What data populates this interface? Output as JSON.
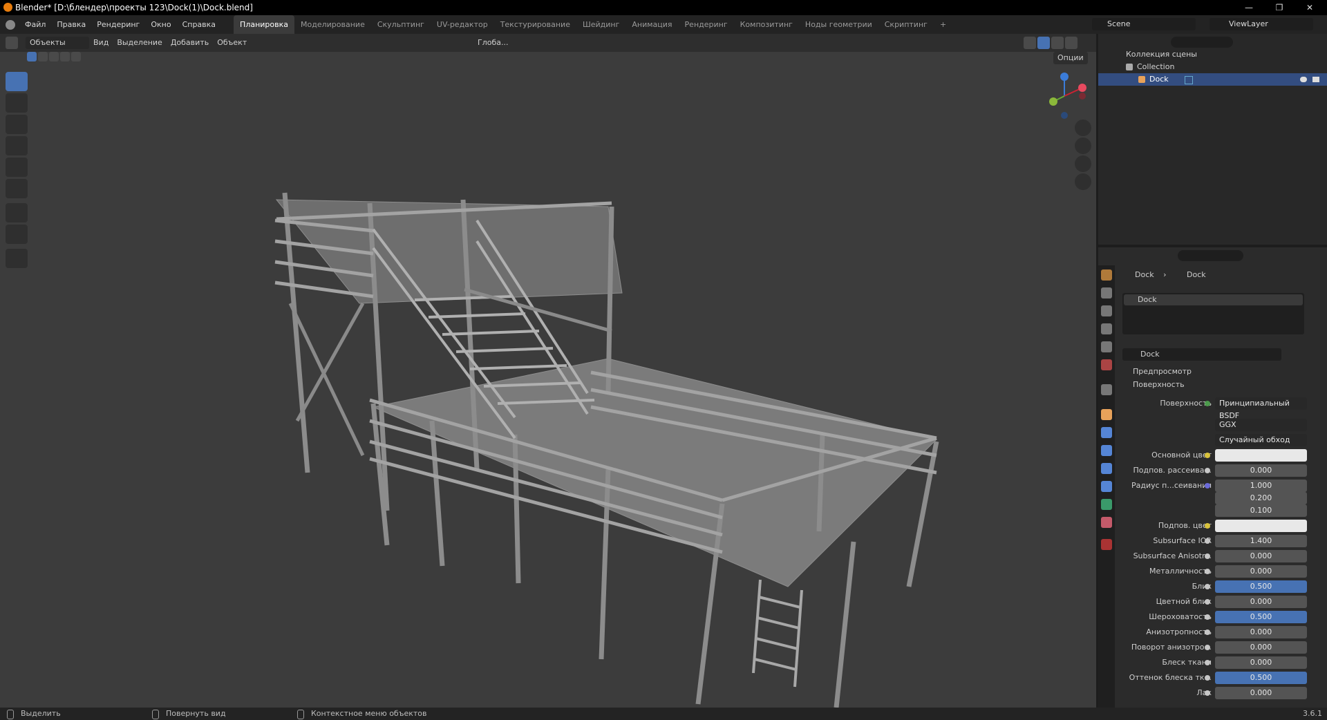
{
  "titlebar": {
    "title": "Blender* [D:\\блендер\\проекты 123\\Dock(1)\\Dock.blend]",
    "minimize": "—",
    "maximize": "❐",
    "close": "✕"
  },
  "menu": {
    "items": [
      "Файл",
      "Правка",
      "Рендеринг",
      "Окно",
      "Справка"
    ]
  },
  "workspaces": {
    "tabs": [
      "Планировка",
      "Моделирование",
      "Скульптинг",
      "UV-редактор",
      "Текстурирование",
      "Шейдинг",
      "Анимация",
      "Рендеринг",
      "Композитинг",
      "Ноды геометрии",
      "Скриптинг"
    ],
    "add": "+"
  },
  "scene": {
    "label": "Scene",
    "view_layer": "ViewLayer"
  },
  "viewport_header": {
    "mode": "Объекты",
    "items": [
      "Вид",
      "Выделение",
      "Добавить",
      "Объект"
    ],
    "orientation": "Глоба...",
    "options": "Опции"
  },
  "outliner": {
    "scene_collection": "Коллекция сцены",
    "collection": "Collection",
    "object": "Dock"
  },
  "properties": {
    "breadcrumb_obj": "Dock",
    "breadcrumb_mat": "Dock",
    "material_slot": "Dock",
    "material_name": "Dock",
    "preview_panel": "Предпросмотр",
    "surface_panel": "Поверхность",
    "rows": [
      {
        "label": "Поверхность",
        "value": "Принципиальный BSDF",
        "kind": "drop"
      },
      {
        "label": "",
        "value": "GGX",
        "kind": "drop"
      },
      {
        "label": "",
        "value": "Случайный обход",
        "kind": "drop"
      },
      {
        "label": "Основной цвет",
        "value": "",
        "kind": "white"
      },
      {
        "label": "Подпов. рассеива...",
        "value": "0.000",
        "kind": "num"
      },
      {
        "label": "Радиус п...сеивания",
        "value": "1.000",
        "kind": "num"
      },
      {
        "label": "",
        "value": "0.200",
        "kind": "num"
      },
      {
        "label": "",
        "value": "0.100",
        "kind": "num"
      },
      {
        "label": "Подпов. цвет",
        "value": "",
        "kind": "white"
      },
      {
        "label": "Subsurface IOR",
        "value": "1.400",
        "kind": "num"
      },
      {
        "label": "Subsurface Anisotr...",
        "value": "0.000",
        "kind": "num"
      },
      {
        "label": "Металличность",
        "value": "0.000",
        "kind": "num"
      },
      {
        "label": "Блик",
        "value": "0.500",
        "kind": "blue"
      },
      {
        "label": "Цветной блик",
        "value": "0.000",
        "kind": "num"
      },
      {
        "label": "Шероховатость",
        "value": "0.500",
        "kind": "blue"
      },
      {
        "label": "Анизотропность",
        "value": "0.000",
        "kind": "num"
      },
      {
        "label": "Поворот анизотро...",
        "value": "0.000",
        "kind": "num"
      },
      {
        "label": "Блеск ткани",
        "value": "0.000",
        "kind": "num"
      },
      {
        "label": "Оттенок блеска тк...",
        "value": "0.500",
        "kind": "blue"
      },
      {
        "label": "Лак",
        "value": "0.000",
        "kind": "num"
      }
    ]
  },
  "statusbar": {
    "select": "Выделить",
    "rotate": "Повернуть вид",
    "context": "Контекстное меню объектов",
    "version": "3.6.1"
  },
  "colors": {
    "accent": "#4772b3",
    "viewport_bg": "#3c3c3c"
  }
}
